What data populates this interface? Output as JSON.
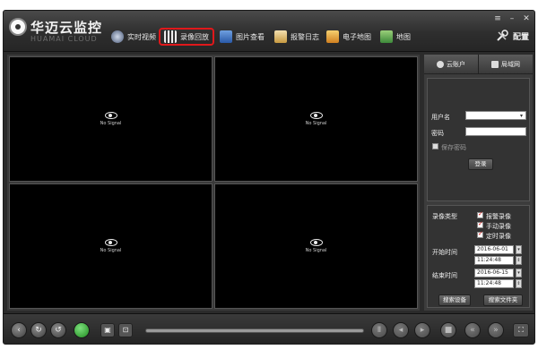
{
  "app": {
    "title": "华迈云监控",
    "subtitle": "HUAMAI CLOUD"
  },
  "nav": [
    {
      "label": "实时视频",
      "icon": "realtime-video-icon"
    },
    {
      "label": "录像回放",
      "icon": "playback-icon"
    },
    {
      "label": "图片查看",
      "icon": "picture-icon"
    },
    {
      "label": "报警日志",
      "icon": "alarm-log-icon"
    },
    {
      "label": "电子地图",
      "icon": "emap-icon"
    },
    {
      "label": "地图",
      "icon": "map-icon"
    }
  ],
  "active_nav": "录像回放",
  "config_label": "配置",
  "video": {
    "no_signal": "No Signal"
  },
  "panel": {
    "tabs": [
      {
        "label": "云账户",
        "icon": "cloud-account-icon"
      },
      {
        "label": "局域网",
        "icon": "lan-icon"
      }
    ],
    "login": {
      "username_label": "用户名",
      "password_label": "密码",
      "remember_label": "保存密码",
      "login_button": "登录"
    },
    "search": {
      "type_label": "录像类型",
      "types": [
        {
          "label": "报警录像",
          "checked": true
        },
        {
          "label": "手动录像",
          "checked": true
        },
        {
          "label": "定时录像",
          "checked": true
        }
      ],
      "start_label": "开始时间",
      "start_date": "2016-06-01",
      "start_time": "11:24:48",
      "end_label": "结束时间",
      "end_date": "2016-06-15",
      "end_time": "11:24:48",
      "search_device_button": "搜索设备",
      "search_file_button": "搜索文件夹"
    }
  },
  "colors": {
    "accent_red": "#e0181b",
    "checkbox_red": "#dd1111"
  }
}
